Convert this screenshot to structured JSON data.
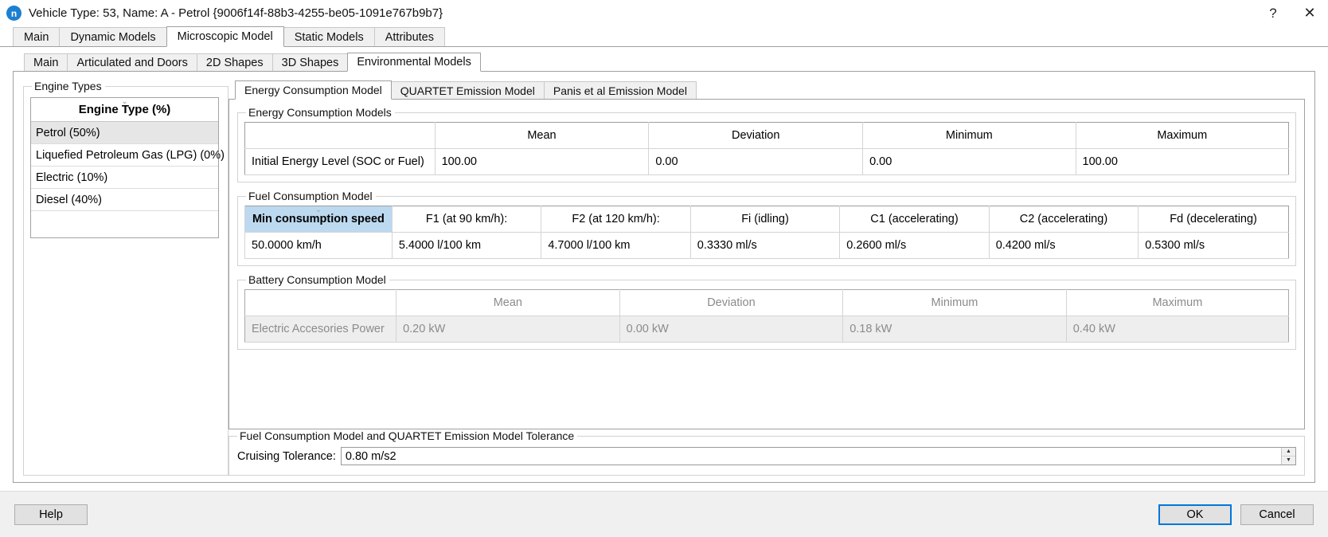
{
  "window": {
    "icon_label": "n",
    "title": "Vehicle Type: 53, Name: A - Petrol  {9006f14f-88b3-4255-be05-1091e767b9b7}",
    "help_button": "?",
    "close_button": "✕"
  },
  "outer_tabs": [
    {
      "label": "Main",
      "active": false
    },
    {
      "label": "Dynamic Models",
      "active": false
    },
    {
      "label": "Microscopic Model",
      "active": true
    },
    {
      "label": "Static Models",
      "active": false
    },
    {
      "label": "Attributes",
      "active": false
    }
  ],
  "inner_tabs": [
    {
      "label": "Main",
      "active": false
    },
    {
      "label": "Articulated and Doors",
      "active": false
    },
    {
      "label": "2D Shapes",
      "active": false
    },
    {
      "label": "3D Shapes",
      "active": false
    },
    {
      "label": "Environmental Models",
      "active": true
    }
  ],
  "engine_types": {
    "group_title": "Engine Types",
    "column_header": "Engine Type (%)",
    "sort_chevron": "⌄",
    "items": [
      {
        "label": "Petrol (50%)",
        "selected": true
      },
      {
        "label": "Liquefied Petroleum Gas (LPG) (0%)",
        "selected": false
      },
      {
        "label": "Electric (10%)",
        "selected": false
      },
      {
        "label": "Diesel (40%)",
        "selected": false
      }
    ]
  },
  "model_tabs": [
    {
      "label": "Energy Consumption Model",
      "active": true
    },
    {
      "label": "QUARTET Emission Model",
      "active": false
    },
    {
      "label": "Panis et al Emission Model",
      "active": false
    }
  ],
  "energy_consumption": {
    "group_title": "Energy Consumption Models",
    "headers": [
      "",
      "Mean",
      "Deviation",
      "Minimum",
      "Maximum"
    ],
    "rows": [
      {
        "label": "Initial Energy Level (SOC or Fuel)",
        "values": [
          "100.00",
          "0.00",
          "0.00",
          "100.00"
        ]
      }
    ]
  },
  "fuel_consumption": {
    "group_title": "Fuel Consumption Model",
    "sort_chevron": "⌄",
    "headers": [
      "Min consumption speed",
      "F1 (at 90 km/h):",
      "F2 (at 120 km/h):",
      "Fi (idling)",
      "C1 (accelerating)",
      "C2 (accelerating)",
      "Fd (decelerating)"
    ],
    "selected_header_index": 0,
    "values": [
      "50.0000  km/h",
      "5.4000  l/100 km",
      "4.7000  l/100 km",
      "0.3330  ml/s",
      "0.2600  ml/s",
      "0.4200  ml/s",
      "0.5300  ml/s"
    ]
  },
  "battery_consumption": {
    "group_title": "Battery Consumption Model",
    "headers": [
      "",
      "Mean",
      "Deviation",
      "Minimum",
      "Maximum"
    ],
    "rows": [
      {
        "label": "Electric Accesories Power",
        "values": [
          "0.20 kW",
          "0.00 kW",
          "0.18 kW",
          "0.40 kW"
        ]
      }
    ]
  },
  "tolerance": {
    "group_title": "Fuel Consumption Model and QUARTET Emission Model Tolerance",
    "label": "Cruising Tolerance:",
    "value": "0.80 m/s2",
    "spin_up": "▲",
    "spin_down": "▼"
  },
  "footer": {
    "help_label": "Help",
    "ok_label": "OK",
    "cancel_label": "Cancel"
  },
  "colors": {
    "accent": "#0078d7",
    "selected_column": "#bcd9ef",
    "selected_row": "#e6e6e6"
  }
}
